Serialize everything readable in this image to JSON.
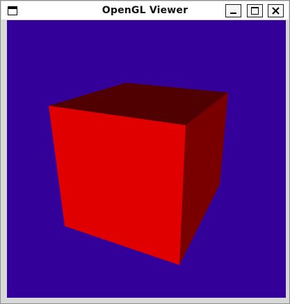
{
  "window": {
    "title": "OpenGL Viewer",
    "controls": [
      "minimize",
      "maximize",
      "close"
    ]
  },
  "icons": {
    "system_menu": "window-icon",
    "minimize": "minimize-icon",
    "maximize": "maximize-icon",
    "close": "close-icon"
  },
  "scene": {
    "background_color": "#330099",
    "object": "cube",
    "faces": {
      "front": "#e00000",
      "right": "#7a0000",
      "top": "#500000"
    }
  }
}
